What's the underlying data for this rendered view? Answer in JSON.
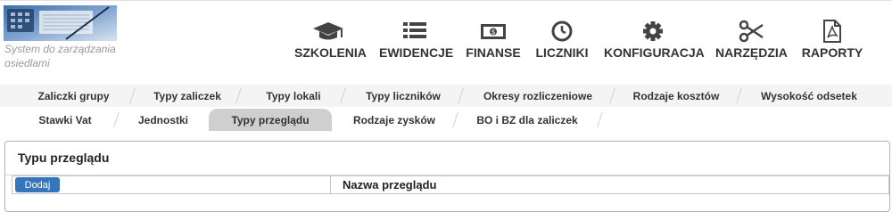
{
  "app": {
    "subtitle": "System do zarządzania osiedlami"
  },
  "nav": {
    "items": [
      {
        "label": "SZKOLENIA",
        "icon": "graduation-cap-icon"
      },
      {
        "label": "EWIDENCJE",
        "icon": "list-icon"
      },
      {
        "label": "FINANSE",
        "icon": "money-icon"
      },
      {
        "label": "LICZNIKI",
        "icon": "clock-icon"
      },
      {
        "label": "KONFIGURACJA",
        "icon": "gear-icon"
      },
      {
        "label": "NARZĘDZIA",
        "icon": "scissors-icon"
      },
      {
        "label": "RAPORTY",
        "icon": "pdf-file-icon"
      }
    ]
  },
  "tabs": {
    "row1": [
      "Zaliczki grupy",
      "Typy zaliczek",
      "Typy lokali",
      "Typy liczników",
      "Okresy rozliczeniowe",
      "Rodzaje kosztów",
      "Wysokość odsetek"
    ],
    "row2": [
      "Stawki Vat",
      "Jednostki",
      "Typy przeglądu",
      "Rodzaje zysków",
      "BO i BZ dla zaliczek"
    ],
    "active": "Typy przeglądu"
  },
  "panel": {
    "title": "Typu przeglądu",
    "add_button": "Dodaj",
    "column_header": "Nazwa przeglądu"
  },
  "colors": {
    "button": "#3475bd",
    "active_tab": "#cfcfcf"
  }
}
